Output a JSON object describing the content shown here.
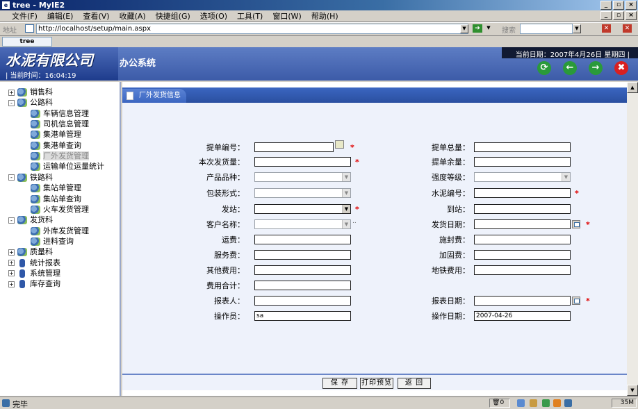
{
  "window": {
    "title": "tree - MyIE2",
    "app_icon": "ie-icon",
    "controls": [
      "_",
      "8",
      "X"
    ]
  },
  "menu": [
    "文件(F)",
    "编辑(E)",
    "查看(V)",
    "收藏(A)",
    "快捷组(G)",
    "选项(O)",
    "工具(T)",
    "窗口(W)",
    "帮助(H)"
  ],
  "address": {
    "label": "地址",
    "url": "http://localhost/setup/main.aspx",
    "search_label": "搜索"
  },
  "tab": {
    "label": "tree"
  },
  "header": {
    "company": "水泥有限公司",
    "system": "办公系统",
    "current_time": "| 当前时间：16:04:19",
    "current_date": "当前日期：2007年4月26日 星期四 |",
    "nav_buttons": [
      {
        "icon": "refresh-icon",
        "color": "#2a9a3a",
        "glyph": "⟳"
      },
      {
        "icon": "back-arrow-icon",
        "color": "#2a9a3a",
        "glyph": "←"
      },
      {
        "icon": "forward-arrow-icon",
        "color": "#2a9a3a",
        "glyph": "→"
      },
      {
        "icon": "close-icon",
        "color": "#d92020",
        "glyph": "✖"
      }
    ]
  },
  "tree": {
    "nodes": [
      {
        "label": "销售科",
        "level": 0,
        "expander": "+",
        "icon": "department-icon"
      },
      {
        "label": "公路科",
        "level": 0,
        "expander": "-",
        "icon": "department-icon"
      },
      {
        "label": "车辆信息管理",
        "level": 1,
        "icon": "department-icon"
      },
      {
        "label": "司机信息管理",
        "level": 1,
        "icon": "department-icon"
      },
      {
        "label": "集港单管理",
        "level": 1,
        "icon": "department-icon"
      },
      {
        "label": "集港单查询",
        "level": 1,
        "icon": "department-icon"
      },
      {
        "label": "厂外发货管理",
        "level": 1,
        "icon": "department-icon",
        "selected": true
      },
      {
        "label": "运输单位运量统计",
        "level": 1,
        "icon": "department-icon"
      },
      {
        "label": "铁路科",
        "level": 0,
        "expander": "-",
        "icon": "department-icon"
      },
      {
        "label": "集站单管理",
        "level": 1,
        "icon": "department-icon"
      },
      {
        "label": "集站单查询",
        "level": 1,
        "icon": "department-icon"
      },
      {
        "label": "火车发货管理",
        "level": 1,
        "icon": "department-icon"
      },
      {
        "label": "发货科",
        "level": 0,
        "expander": "-",
        "icon": "department-icon"
      },
      {
        "label": "外库发货管理",
        "level": 1,
        "icon": "department-icon"
      },
      {
        "label": "进料查询",
        "level": 1,
        "icon": "department-icon"
      },
      {
        "label": "质量科",
        "level": 0,
        "expander": "+",
        "icon": "department-icon"
      },
      {
        "label": "统计报表",
        "level": 0,
        "expander": "+",
        "icon": "book-icon"
      },
      {
        "label": "系统管理",
        "level": 0,
        "expander": "+",
        "icon": "book-icon"
      },
      {
        "label": "库存查询",
        "level": 0,
        "expander": "+",
        "icon": "book-icon"
      }
    ]
  },
  "panel": {
    "title": "厂外发货信息"
  },
  "form": {
    "left": [
      {
        "label": "提单编号：",
        "type": "text",
        "value": "",
        "required": true,
        "lookup": true
      },
      {
        "label": "本次发货量：",
        "type": "text",
        "value": "",
        "required": true
      },
      {
        "label": "产品品种：",
        "type": "select",
        "value": ""
      },
      {
        "label": "包装形式：",
        "type": "select",
        "value": ""
      },
      {
        "label": "发站：",
        "type": "select",
        "value": "",
        "required": true,
        "active": true
      },
      {
        "label": "客户名称：",
        "type": "select",
        "value": "",
        "dots": ".."
      },
      {
        "label": "运费：",
        "type": "text",
        "value": ""
      },
      {
        "label": "服务费：",
        "type": "text",
        "value": ""
      },
      {
        "label": "其他费用：",
        "type": "text",
        "value": ""
      },
      {
        "label": "费用合计：",
        "type": "text",
        "value": ""
      },
      {
        "label": "报表人：",
        "type": "text",
        "value": ""
      },
      {
        "label": "操作员：",
        "type": "text",
        "value": "sa"
      }
    ],
    "right": [
      {
        "label": "提单总量：",
        "type": "text",
        "value": ""
      },
      {
        "label": "提单余量：",
        "type": "text",
        "value": ""
      },
      {
        "label": "强度等级：",
        "type": "select",
        "value": ""
      },
      {
        "label": "水泥编号：",
        "type": "text",
        "value": "",
        "required": true
      },
      {
        "label": "到站：",
        "type": "text",
        "value": ""
      },
      {
        "label": "发货日期：",
        "type": "date",
        "value": "",
        "required": true
      },
      {
        "label": "施封费：",
        "type": "text",
        "value": ""
      },
      {
        "label": "加固费：",
        "type": "text",
        "value": ""
      },
      {
        "label": "地铁费用：",
        "type": "text",
        "value": ""
      },
      {
        "label": "",
        "type": "none"
      },
      {
        "label": "报表日期：",
        "type": "date",
        "value": "",
        "required": true
      },
      {
        "label": "操作日期：",
        "type": "text",
        "value": "2007-04-26"
      }
    ],
    "required_mark": "*"
  },
  "buttons": {
    "save": "保 存",
    "print_preview": "打印预览",
    "back": "返 回"
  },
  "status": {
    "text": "完毕",
    "recycle_count": "0",
    "memory": "35M"
  }
}
